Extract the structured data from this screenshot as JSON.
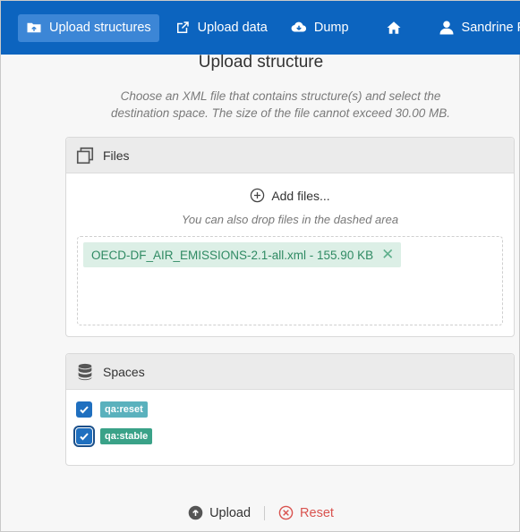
{
  "nav": {
    "upload_structures": "Upload structures",
    "upload_data": "Upload data",
    "dump": "Dump",
    "user_name": "Sandrine Phelipe"
  },
  "page": {
    "title": "Upload structure",
    "description": "Choose an XML file that contains structure(s) and select the destination space. The size of the file cannot exceed 30.00 MB."
  },
  "files_panel": {
    "heading": "Files",
    "add_files": "Add files...",
    "drop_hint": "You can also drop files in the dashed area",
    "files": [
      {
        "label": "OECD-DF_AIR_EMISSIONS-2.1-all.xml - 155.90 KB",
        "remove": "✕"
      }
    ]
  },
  "spaces_panel": {
    "heading": "Spaces",
    "spaces": [
      {
        "label": "qa:reset",
        "checked": true,
        "color": "#5ab1bd"
      },
      {
        "label": "qa:stable",
        "checked": true,
        "color": "#3aa288"
      }
    ]
  },
  "actions": {
    "upload": "Upload",
    "reset": "Reset"
  },
  "colors": {
    "nav_bg": "#0c64bf",
    "nav_active": "#3c86d6",
    "reset": "#d9534f"
  }
}
